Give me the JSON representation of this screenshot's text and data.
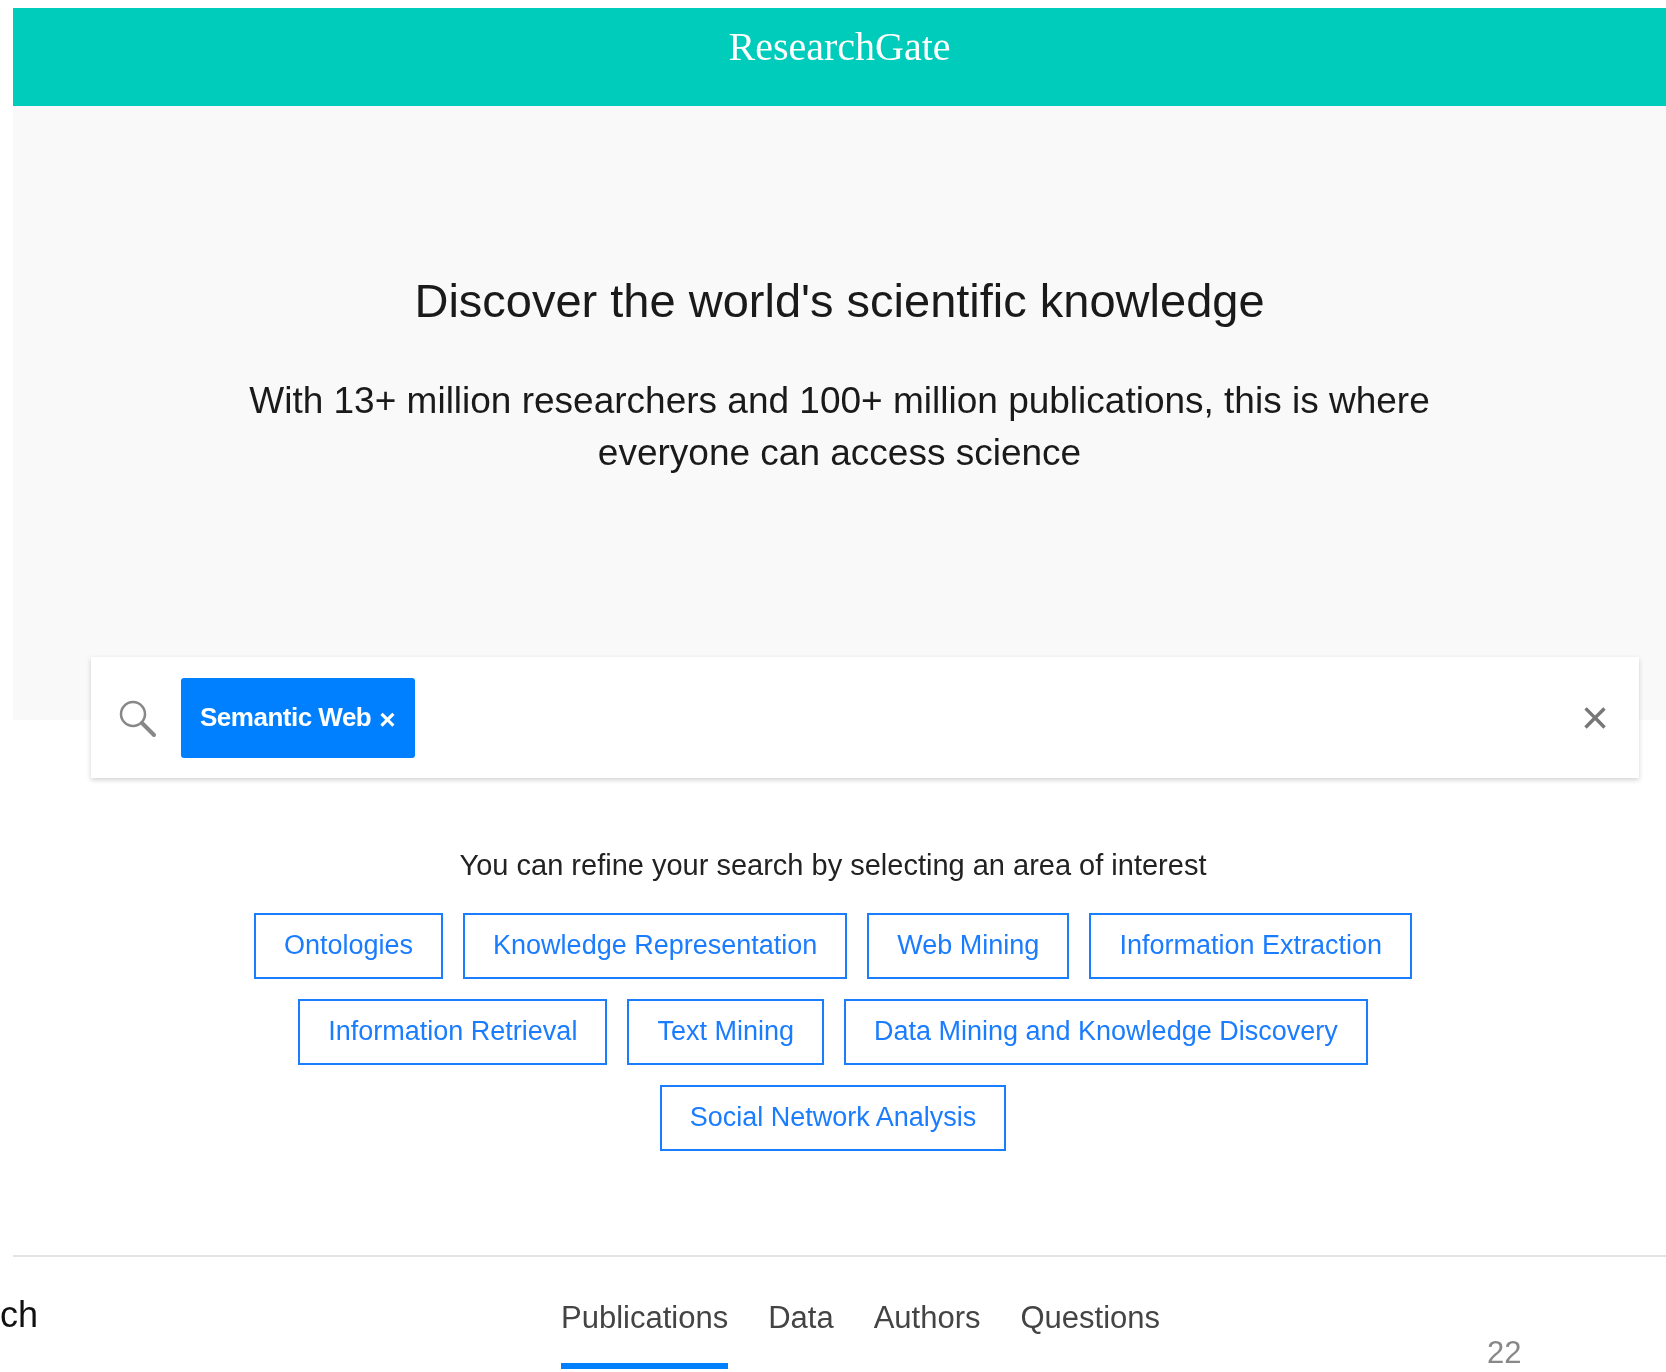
{
  "header": {
    "logo": "ResearchGate"
  },
  "hero": {
    "title": "Discover the world's scientific knowledge",
    "subtitle": "With 13+ million researchers and 100+ million publications, this is where everyone can access science"
  },
  "search": {
    "chips": [
      {
        "label": "Semantic Web",
        "remove": "×"
      }
    ],
    "clear": "×"
  },
  "refine": {
    "text": "You can refine your search by selecting an area of interest",
    "tag_rows": [
      [
        "Ontologies",
        "Knowledge Representation",
        "Web Mining",
        "Information Extraction"
      ],
      [
        "Information Retrieval",
        "Text Mining",
        "Data Mining and Knowledge Discovery"
      ],
      [
        "Social Network Analysis"
      ]
    ]
  },
  "side_text": "ch",
  "tabs": [
    {
      "label": "Publications",
      "selected": true
    },
    {
      "label": "Data",
      "selected": false
    },
    {
      "label": "Authors",
      "selected": false
    },
    {
      "label": "Questions",
      "selected": false
    }
  ],
  "page_number": "22"
}
